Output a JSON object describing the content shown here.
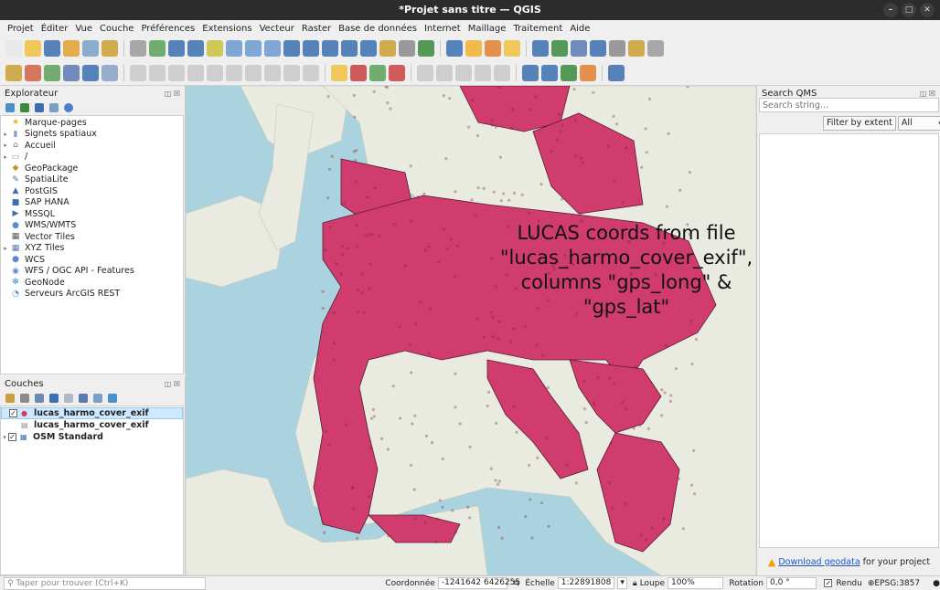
{
  "window": {
    "title": "*Projet sans titre — QGIS"
  },
  "menu": [
    "Projet",
    "Éditer",
    "Vue",
    "Couche",
    "Préférences",
    "Extensions",
    "Vecteur",
    "Raster",
    "Base de données",
    "Internet",
    "Maillage",
    "Traitement",
    "Aide"
  ],
  "explorer": {
    "title": "Explorateur",
    "items": [
      {
        "label": "Marque-pages",
        "icon": "star-icon",
        "arrow": ""
      },
      {
        "label": "Signets spatiaux",
        "icon": "bookmark-icon",
        "arrow": "▸"
      },
      {
        "label": "Accueil",
        "icon": "home-folder-icon",
        "arrow": "▸"
      },
      {
        "label": "/",
        "icon": "folder-icon",
        "arrow": "▸"
      },
      {
        "label": "GeoPackage",
        "icon": "geopackage-icon",
        "arrow": ""
      },
      {
        "label": "SpatiaLite",
        "icon": "spatialite-icon",
        "arrow": ""
      },
      {
        "label": "PostGIS",
        "icon": "postgis-icon",
        "arrow": ""
      },
      {
        "label": "SAP HANA",
        "icon": "sap-hana-icon",
        "arrow": ""
      },
      {
        "label": "MSSQL",
        "icon": "mssql-icon",
        "arrow": ""
      },
      {
        "label": "WMS/WMTS",
        "icon": "wms-icon",
        "arrow": ""
      },
      {
        "label": "Vector Tiles",
        "icon": "vector-tiles-icon",
        "arrow": ""
      },
      {
        "label": "XYZ Tiles",
        "icon": "xyz-tiles-icon",
        "arrow": "▸"
      },
      {
        "label": "WCS",
        "icon": "wcs-icon",
        "arrow": ""
      },
      {
        "label": "WFS / OGC API - Features",
        "icon": "wfs-icon",
        "arrow": ""
      },
      {
        "label": "GeoNode",
        "icon": "geonode-icon",
        "arrow": ""
      },
      {
        "label": "Serveurs ArcGIS REST",
        "icon": "arcgis-icon",
        "arrow": ""
      }
    ]
  },
  "layers": {
    "title": "Couches",
    "items": [
      {
        "label": "lucas_harmo_cover_exif",
        "checked": "✓",
        "arrow": "",
        "selected": true
      },
      {
        "label": "lucas_harmo_cover_exif",
        "checked": "",
        "arrow": "",
        "selected": false
      },
      {
        "label": "OSM Standard",
        "checked": "✓",
        "arrow": "▾",
        "selected": false
      }
    ]
  },
  "map": {
    "annotation": "LUCAS coords from file \"lucas_harmo_cover_exif\", columns \"gps_long\" & \"gps_lat\"",
    "point_color": "#d03c6e",
    "sea_color": "#aad3df",
    "land_color": "#e9ebe1"
  },
  "qms": {
    "title": "Search QMS",
    "search_placeholder": "Search string...",
    "filter_label": "Filter by extent",
    "filter_value": "All",
    "download_link": "Download geodata",
    "download_suffix": "for your project"
  },
  "status": {
    "locator_placeholder": "Taper pour trouver (Ctrl+K)",
    "coord_label": "Coordonnée",
    "coord_value": "-1241642 6426255",
    "scale_label": "Échelle",
    "scale_value": "1:22891808",
    "magnifier_label": "Loupe",
    "magnifier_value": "100%",
    "rotation_label": "Rotation",
    "rotation_value": "0,0 °",
    "render_label": "Rendu",
    "crs_label": "EPSG:3857"
  }
}
